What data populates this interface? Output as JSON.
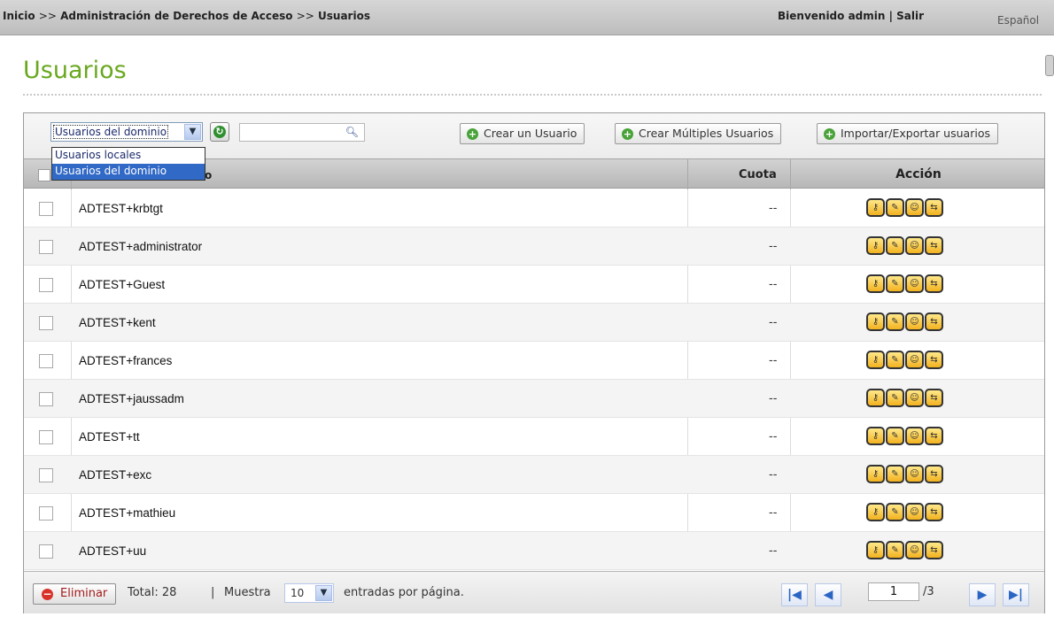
{
  "topbar": {
    "crumb1": "Inicio",
    "crumb2": "Administración de Derechos de Acceso",
    "crumb3": "Usuarios",
    "separator": ">>",
    "welcome": "Bienvenido admin | Salir",
    "language": "Español"
  },
  "page": {
    "title": "Usuarios"
  },
  "toolbar": {
    "filter_selected": "Usuarios del dominio",
    "filter_options": [
      "Usuarios locales",
      "Usuarios del dominio"
    ],
    "search_value": "",
    "create_user": "Crear un Usuario",
    "create_multiple": "Crear Múltiples Usuarios",
    "import_export": "Importar/Exportar usuarios"
  },
  "table": {
    "header_name_partial": "o",
    "header_quota": "Cuota",
    "header_action": "Acción",
    "rows": [
      {
        "name": "ADTEST+krbtgt",
        "quota": "--"
      },
      {
        "name": "ADTEST+administrator",
        "quota": "--"
      },
      {
        "name": "ADTEST+Guest",
        "quota": "--"
      },
      {
        "name": "ADTEST+kent",
        "quota": "--"
      },
      {
        "name": "ADTEST+frances",
        "quota": "--"
      },
      {
        "name": "ADTEST+jaussadm",
        "quota": "--"
      },
      {
        "name": "ADTEST+tt",
        "quota": "--"
      },
      {
        "name": "ADTEST+exc",
        "quota": "--"
      },
      {
        "name": "ADTEST+mathieu",
        "quota": "--"
      },
      {
        "name": "ADTEST+uu",
        "quota": "--"
      }
    ],
    "action_icons": [
      "password-icon",
      "edit-icon",
      "user-group-icon",
      "folder-permission-icon"
    ]
  },
  "footer": {
    "delete": "Eliminar",
    "total": "Total: 28",
    "sep": "|",
    "show": "Muestra",
    "per_page": "10",
    "entries": "entradas por página.",
    "current_page": "1",
    "page_total": "/3"
  }
}
